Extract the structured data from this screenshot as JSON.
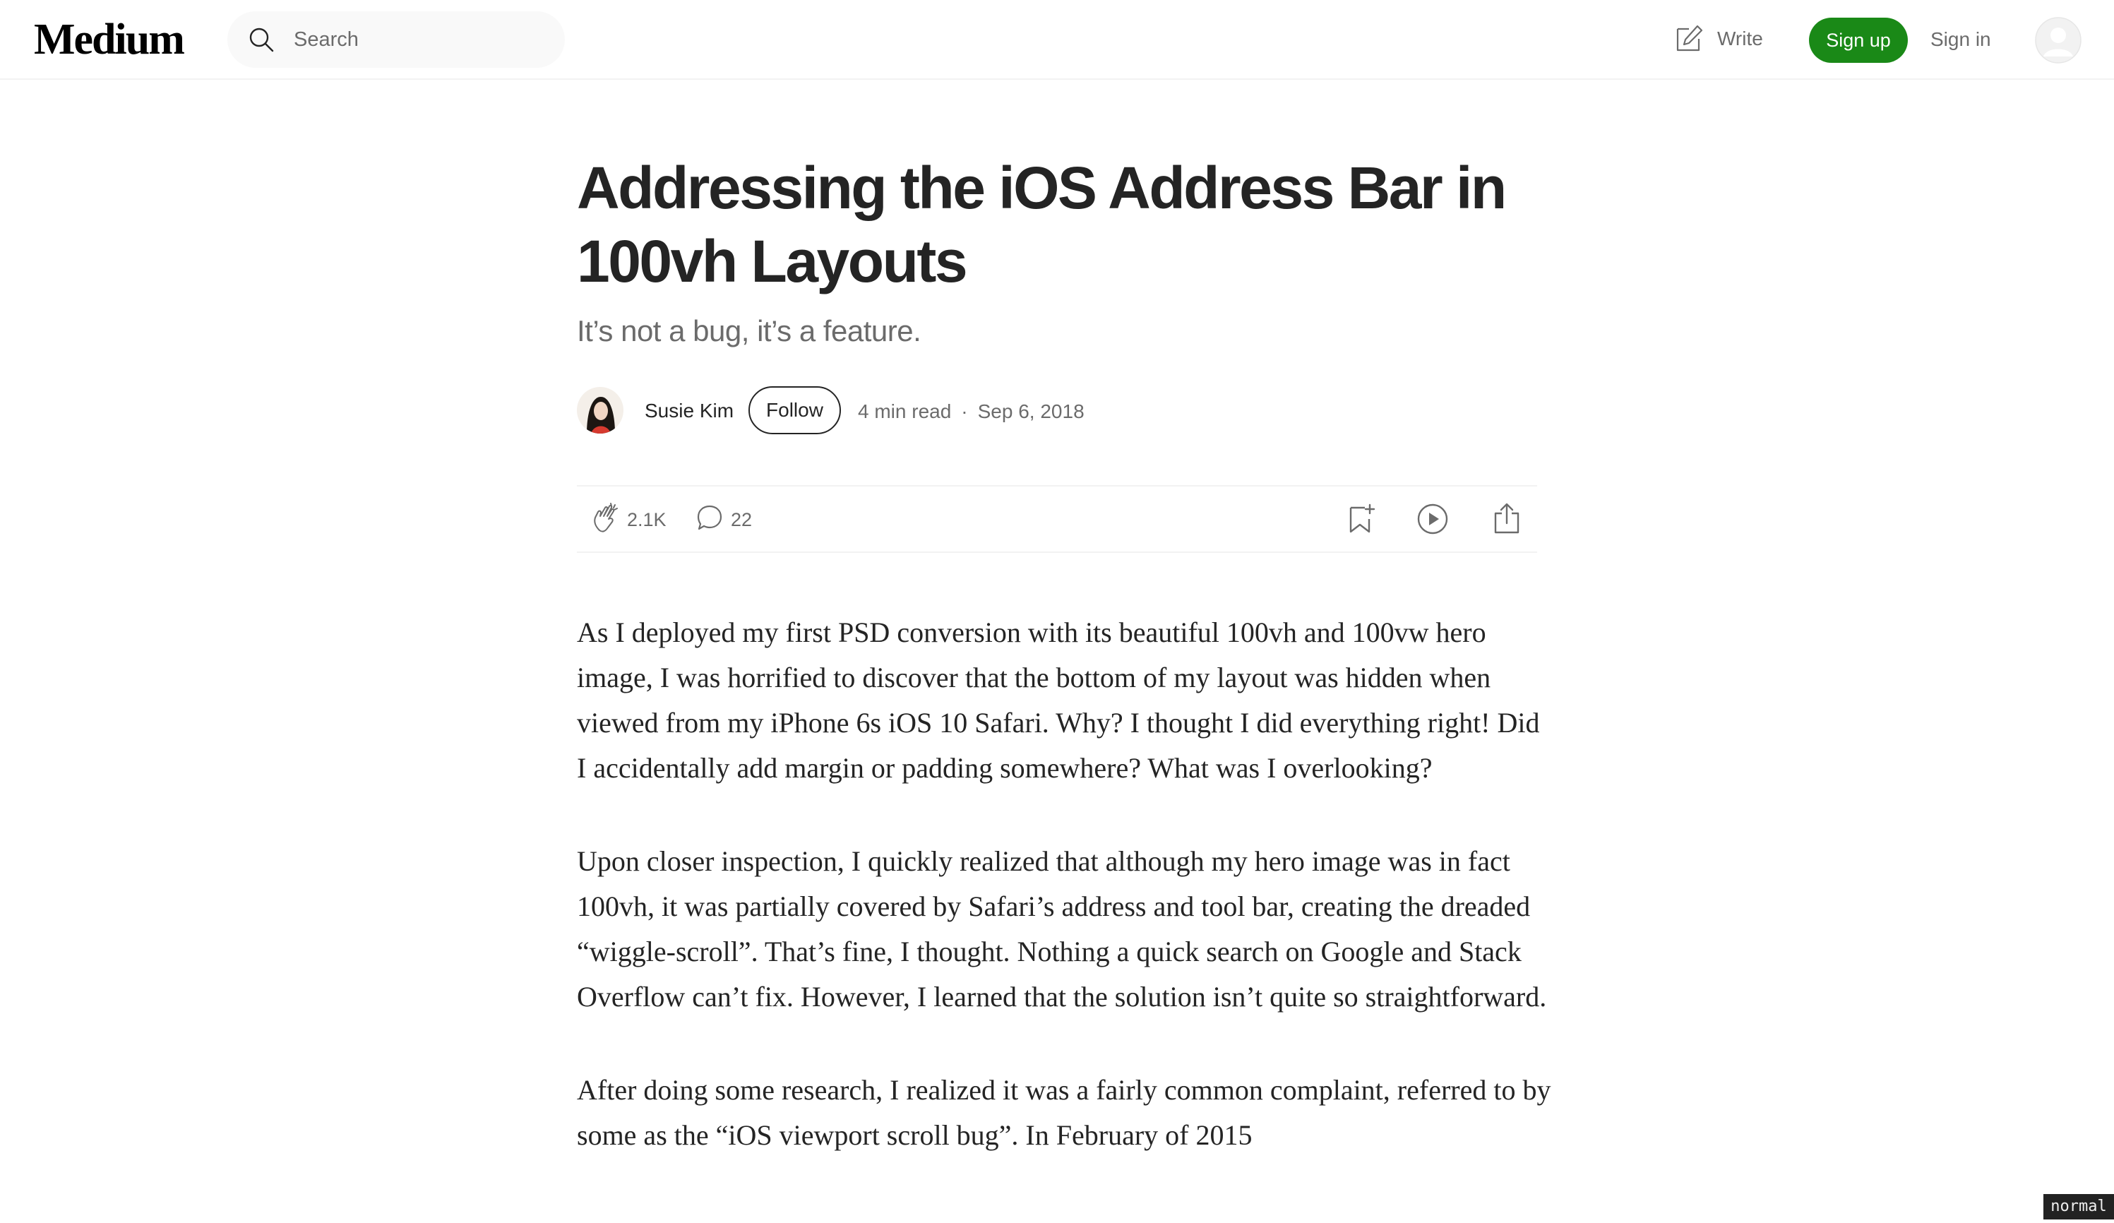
{
  "nav": {
    "logo": "Medium",
    "search_placeholder": "Search",
    "write_label": "Write",
    "signup_label": "Sign up",
    "signin_label": "Sign in"
  },
  "article": {
    "title": "Addressing the iOS Address Bar in 100vh Layouts",
    "subtitle": "It’s not a bug, it’s a feature.",
    "author": "Susie Kim",
    "follow_label": "Follow",
    "read_time": "4 min read",
    "separator": "·",
    "date": "Sep 6, 2018",
    "claps": "2.1K",
    "responses": "22",
    "paragraphs": [
      "As I deployed my first PSD conversion with its beautiful 100vh and 100vw hero image, I was horrified to discover that the bottom of my layout was hidden when viewed from my iPhone 6s iOS 10 Safari. Why? I thought I did everything right! Did I accidentally add margin or padding somewhere? What was I overlooking?",
      "Upon closer inspection, I quickly realized that although my hero image was in fact 100vh, it was partially covered by Safari’s address and tool bar, creating the dreaded “wiggle-scroll”. That’s fine, I thought. Nothing a quick search on Google and Stack Overflow can’t fix. However, I learned that the solution isn’t quite so straightforward.",
      "After doing some research, I realized it was a fairly common complaint, referred to by some as the “iOS viewport scroll bug”. In February of 2015"
    ]
  },
  "mode_badge": "normal",
  "colors": {
    "brand_green": "#1a8917",
    "text": "#242424",
    "muted": "#6b6b6b"
  },
  "icons": [
    "search-icon",
    "write-icon",
    "user-avatar-icon",
    "clap-icon",
    "response-icon",
    "bookmark-icon",
    "listen-icon",
    "share-icon"
  ]
}
